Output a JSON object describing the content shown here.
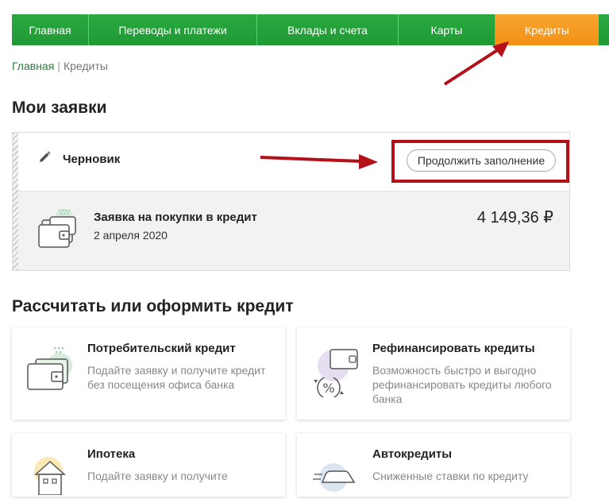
{
  "nav": {
    "items": [
      {
        "label": "Главная",
        "active": false
      },
      {
        "label": "Переводы и платежи",
        "active": false
      },
      {
        "label": "Вклады и счета",
        "active": false
      },
      {
        "label": "Карты",
        "active": false
      },
      {
        "label": "Кредиты",
        "active": true
      }
    ]
  },
  "breadcrumb": {
    "home": "Главная",
    "separator": "|",
    "current": "Кредиты"
  },
  "applications": {
    "title": "Мои заявки",
    "draft_label": "Черновик",
    "continue_label": "Продолжить заполнение",
    "item": {
      "title": "Заявка на покупки в кредит",
      "date": "2 апреля 2020",
      "amount": "4 149,36 ₽"
    }
  },
  "calculate": {
    "title": "Рассчитать или оформить кредит",
    "cards": [
      {
        "title": "Потребительский кредит",
        "desc": "Подайте заявку и получите кредит без посещения офиса банка"
      },
      {
        "title": "Рефинансировать кредиты",
        "desc": "Возможность быстро и выгодно рефинансировать кредиты любого банка"
      },
      {
        "title": "Ипотека",
        "desc": "Подайте заявку и получите"
      },
      {
        "title": "Автокредиты",
        "desc": "Сниженные ставки по кредиту"
      }
    ]
  },
  "colors": {
    "nav_green": "#21a038",
    "nav_active_orange": "#f29115",
    "annotation_red": "#b4101a"
  }
}
